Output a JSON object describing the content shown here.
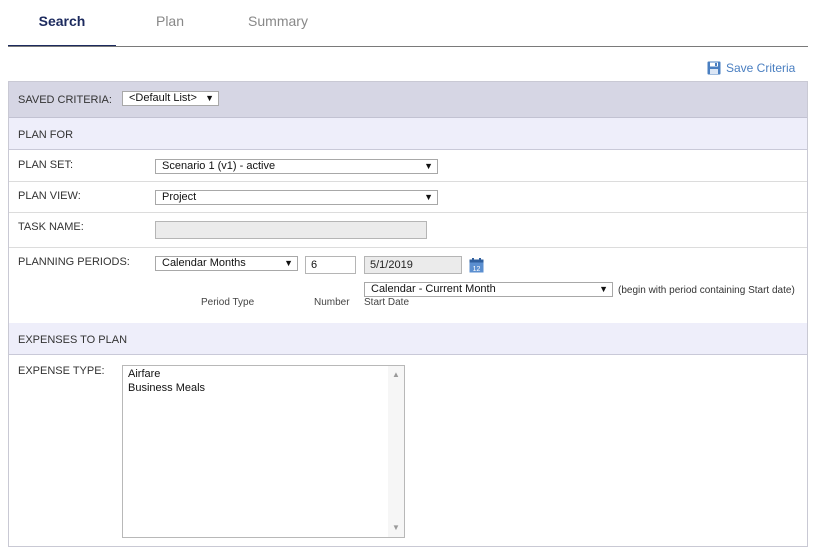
{
  "tabs": [
    {
      "label": "Search"
    },
    {
      "label": "Plan"
    },
    {
      "label": "Summary"
    }
  ],
  "save_criteria": {
    "label": "Save Criteria",
    "icon": "floppy-disk-icon",
    "color": "#4a7fc1"
  },
  "saved_criteria": {
    "label": "SAVED CRITERIA:",
    "value": "<Default List>"
  },
  "plan_for": {
    "section_title": "PLAN FOR",
    "plan_set": {
      "label": "PLAN SET:",
      "value": "Scenario 1 (v1) - active"
    },
    "plan_view": {
      "label": "PLAN VIEW:",
      "value": "Project"
    },
    "task_name": {
      "label": "TASK NAME:",
      "value": ""
    },
    "planning_periods": {
      "label": "PLANNING PERIODS:",
      "period_type": "Calendar Months",
      "number": "6",
      "start_date": "5/1/2019",
      "start_option": "Calendar - Current Month",
      "note": "(begin with period containing Start date)",
      "caption_period_type": "Period Type",
      "caption_number": "Number",
      "caption_start_date": "Start Date"
    }
  },
  "expenses_to_plan": {
    "section_title": "EXPENSES TO PLAN",
    "expense_type": {
      "label": "EXPENSE TYPE:",
      "options": [
        "Airfare",
        "Business Meals"
      ]
    }
  },
  "colors": {
    "accent": "#1c2a5e",
    "link": "#4a7fc1",
    "header_band": "#d6d6e4",
    "section_band": "#eeeefa"
  }
}
